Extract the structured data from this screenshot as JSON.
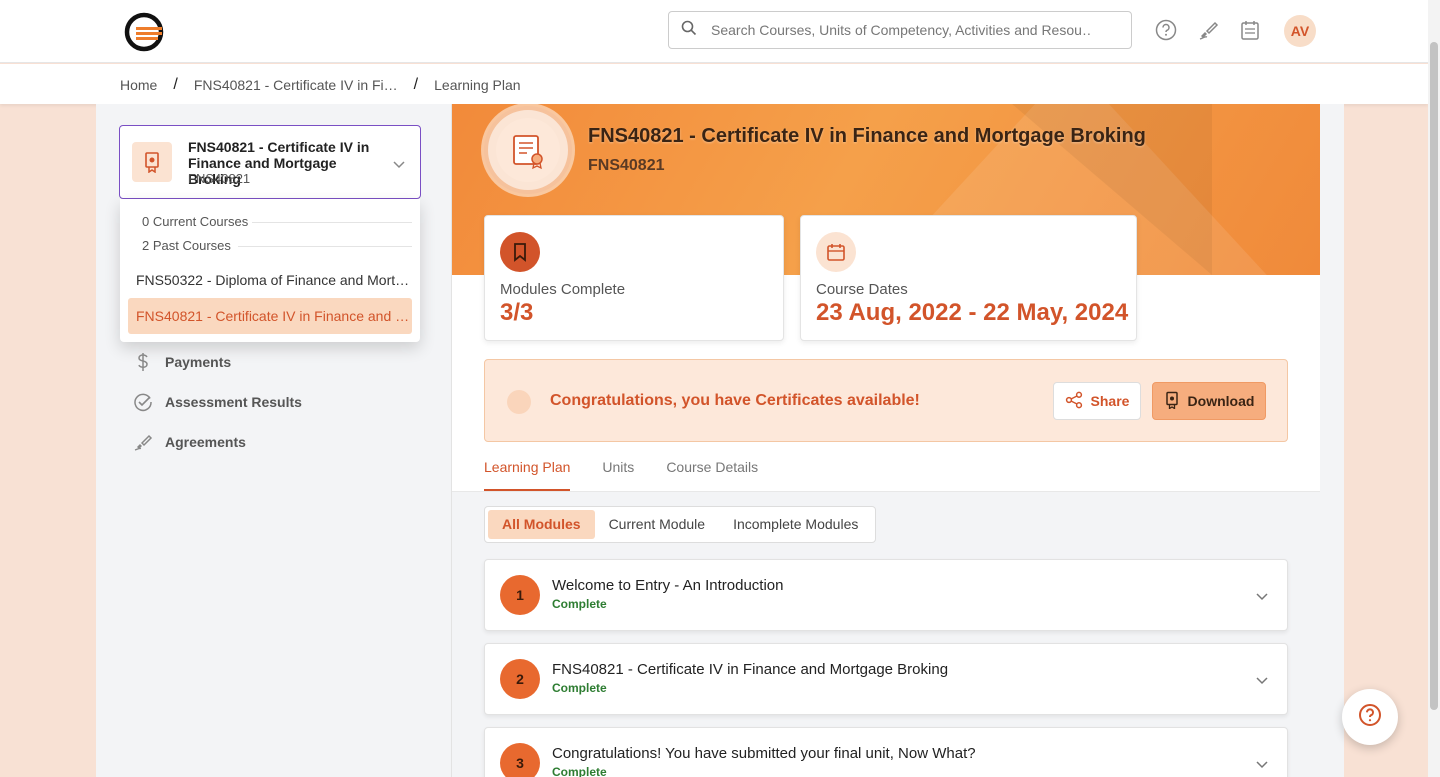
{
  "header": {
    "search_placeholder": "Search Courses, Units of Competency, Activities and Resou…",
    "avatar_initials": "AV"
  },
  "breadcrumb": {
    "items": [
      "Home",
      "FNS40821 - Certificate IV in Fi…",
      "Learning Plan"
    ]
  },
  "sidebar": {
    "selected_course": {
      "title": "FNS40821 - Certificate IV in Finance and Mortgage Broking",
      "code": "FNS40821"
    },
    "dropdown": {
      "current_label": "0 Current Courses",
      "past_label": "2 Past Courses",
      "items": [
        "FNS50322 - Diploma of Finance and Mort…",
        "FNS40821 - Certificate IV in Finance and …"
      ]
    },
    "nav": [
      {
        "label": "Payments",
        "icon": "dollar-icon"
      },
      {
        "label": "Assessment Results",
        "icon": "check-circle-icon"
      },
      {
        "label": "Agreements",
        "icon": "signature-icon"
      }
    ]
  },
  "course": {
    "title": "FNS40821 - Certificate IV in Finance and Mortgage Broking",
    "code": "FNS40821"
  },
  "stats": {
    "modules_label": "Modules Complete",
    "modules_value": "3/3",
    "dates_label": "Course Dates",
    "dates_value": "23 Aug, 2022 - 22 May, 2024"
  },
  "certificate": {
    "message": "Congratulations, you have Certificates available!",
    "share_label": "Share",
    "download_label": "Download"
  },
  "tabs": [
    "Learning Plan",
    "Units",
    "Course Details"
  ],
  "filters": [
    "All Modules",
    "Current Module",
    "Incomplete Modules"
  ],
  "modules": [
    {
      "num": "1",
      "title": "Welcome to Entry - An Introduction",
      "status": "Complete"
    },
    {
      "num": "2",
      "title": "FNS40821 - Certificate IV in Finance and Mortgage Broking",
      "status": "Complete"
    },
    {
      "num": "3",
      "title": "Congratulations! You have submitted your final unit, Now What?",
      "status": "Complete"
    }
  ],
  "colors": {
    "accent": "#d2542a",
    "banner": "#f28a3a",
    "complete": "#2e7d32"
  }
}
